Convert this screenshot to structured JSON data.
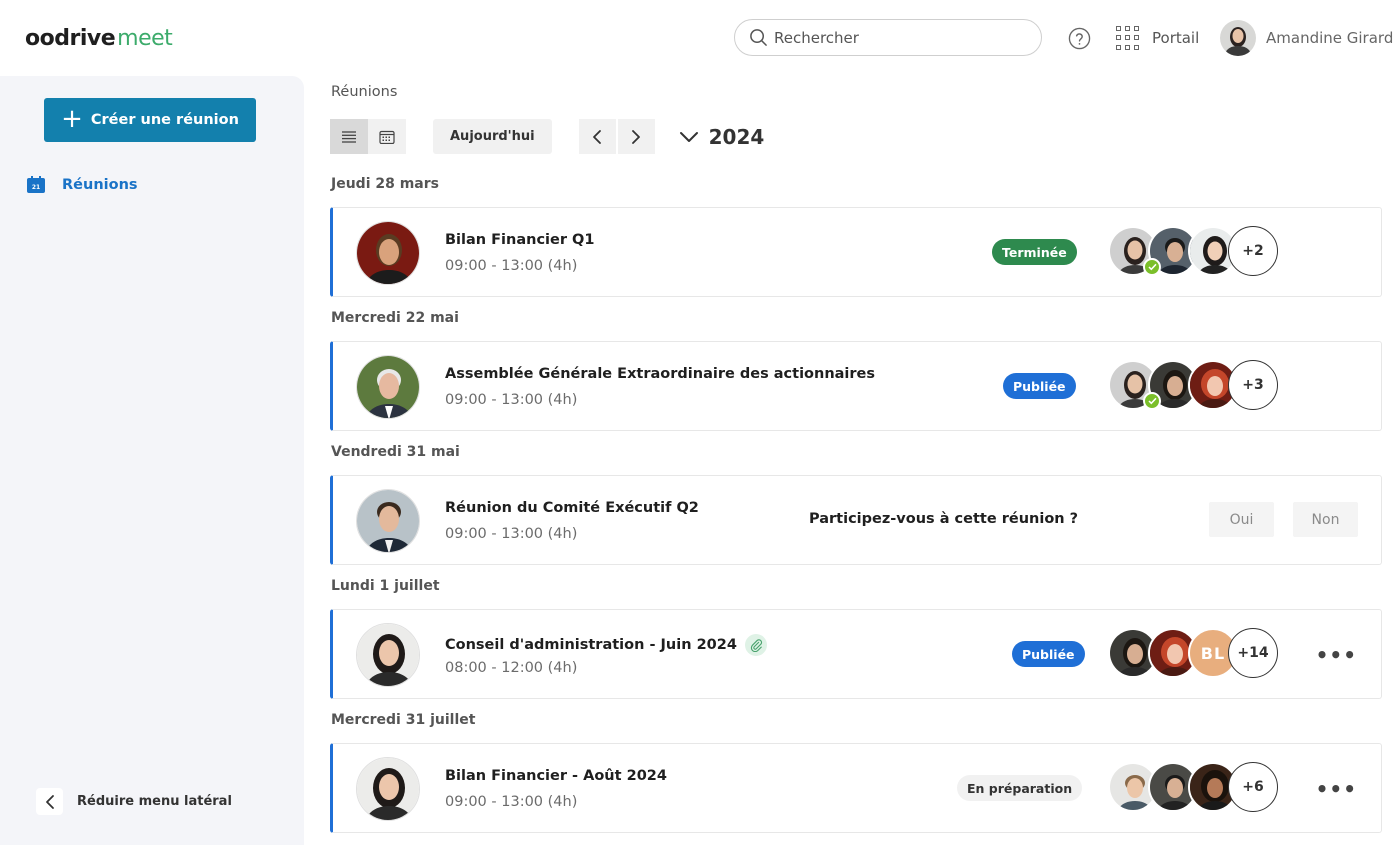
{
  "header": {
    "logo_mark": "oo",
    "logo_word": "drive",
    "logo_product": "meet",
    "search_placeholder": "Rechercher",
    "portal_label": "Portail",
    "user_name": "Amandine Girard"
  },
  "sidebar": {
    "create_button": "Créer une réunion",
    "nav_items": [
      {
        "label": "Réunions",
        "icon": "calendar-icon"
      }
    ],
    "collapse_label": "Réduire menu latéral"
  },
  "main": {
    "breadcrumb": "Réunions",
    "today_button": "Aujourd'hui",
    "year": "2024",
    "meetings": [
      {
        "day": "Jeudi 28 mars",
        "title": "Bilan Financier Q1",
        "time": "09:00 - 13:00 (4h)",
        "status": "Terminée",
        "more_participants": "+2"
      },
      {
        "day": "Mercredi 22 mai",
        "title": "Assemblée Générale Extraordinaire des actionnaires",
        "time": "09:00 - 13:00 (4h)",
        "status": "Publiée",
        "more_participants": "+3"
      },
      {
        "day": "Vendredi 31 mai",
        "title": "Réunion du Comité Exécutif Q2",
        "time": "09:00 - 13:00 (4h)",
        "question": "Participez-vous à cette réunion ?",
        "yes": "Oui",
        "no": "Non"
      },
      {
        "day": "Lundi 1 juillet",
        "title": "Conseil d'administration - Juin 2024",
        "time": "08:00 - 12:00 (4h)",
        "status": "Publiée",
        "initials": "BL",
        "more_participants": "+14",
        "menu": "•••"
      },
      {
        "day": "Mercredi 31 juillet",
        "title": "Bilan Financier - Août 2024",
        "time": "09:00 - 13:00 (4h)",
        "status": "En préparation",
        "more_participants": "+6",
        "menu": "•••"
      }
    ]
  },
  "colors": {
    "primary_button": "#1380ad",
    "accent_blue": "#1f6fd6",
    "done_green": "#2e8a4e",
    "logo_green": "#3cab6b"
  }
}
